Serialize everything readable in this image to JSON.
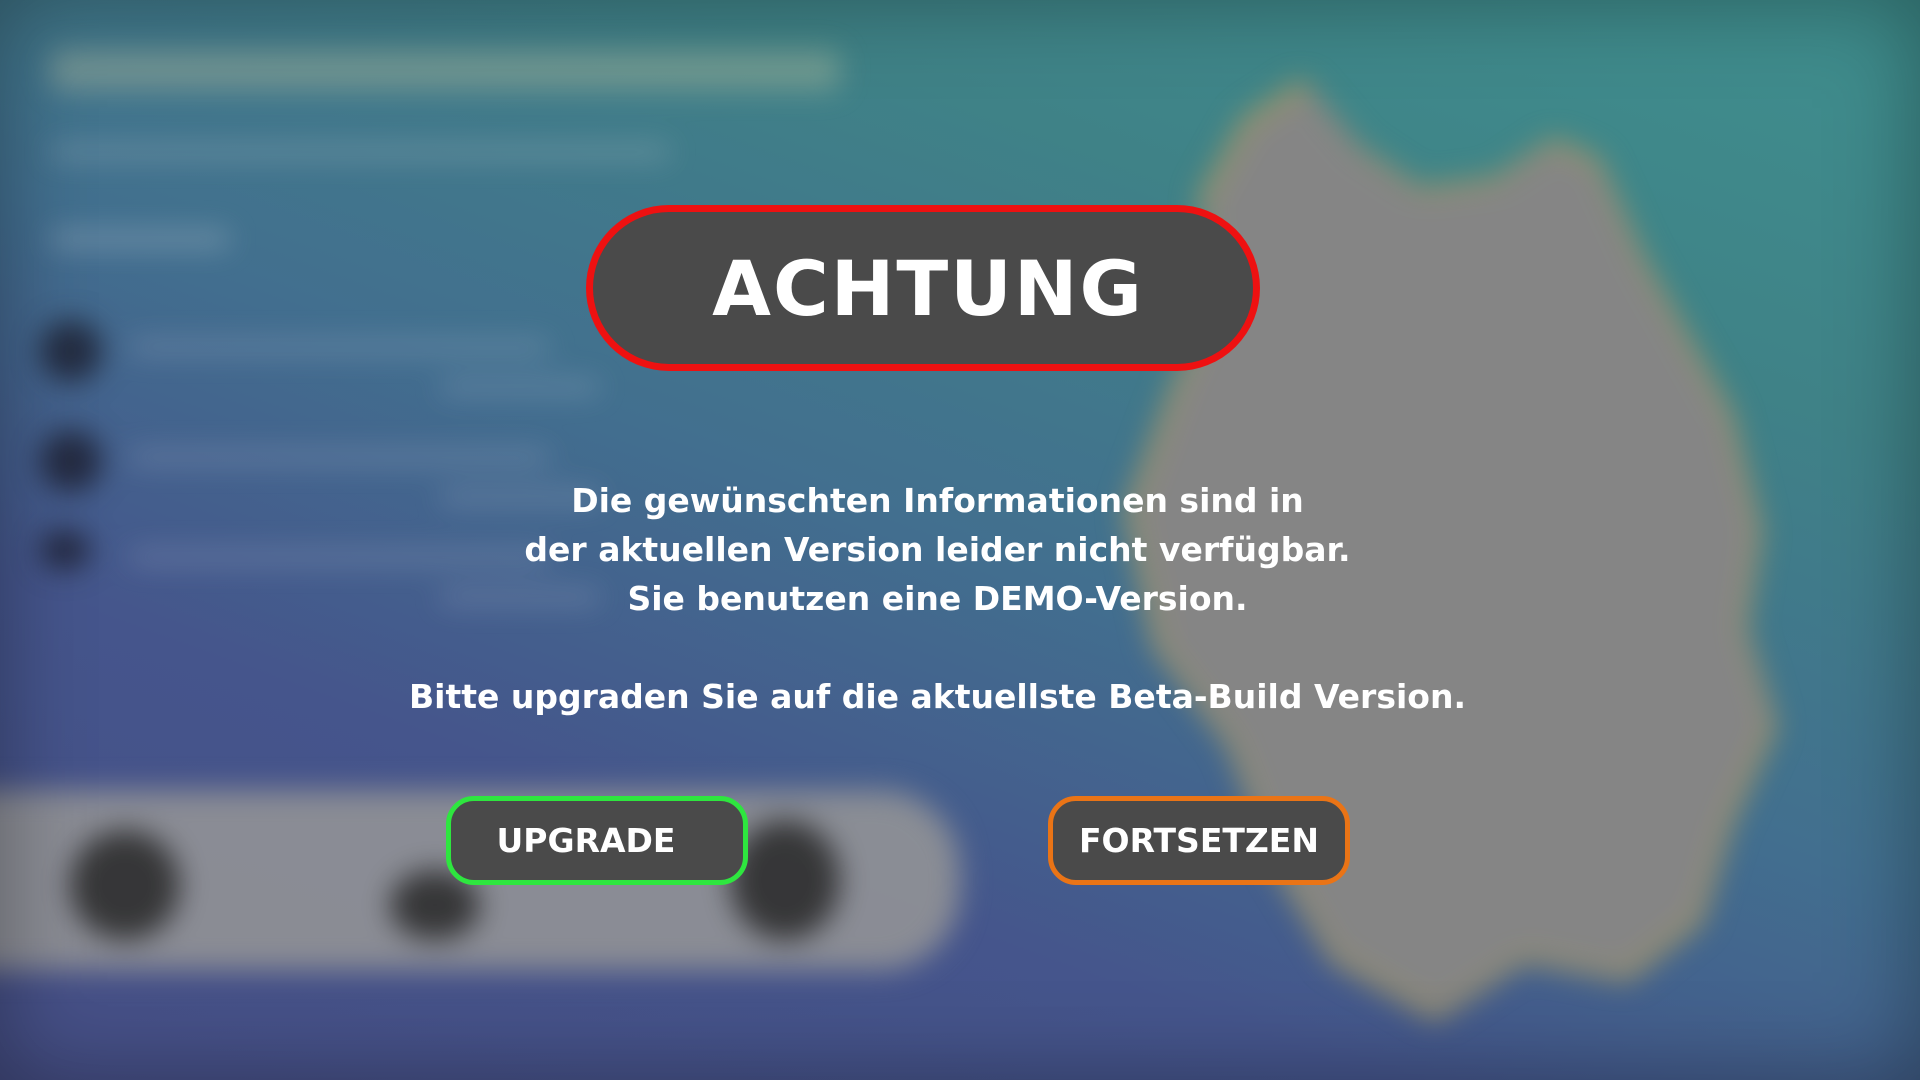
{
  "dialog": {
    "title": "ACHTUNG",
    "message_lines": [
      "Die gewünschten Informationen sind in",
      "der aktuellen Version leider nicht verfügbar.",
      "Sie benutzen eine DEMO-Version."
    ],
    "upgrade_note": "Bitte upgraden Sie auf die aktuellste Beta-Build Version.",
    "buttons": {
      "upgrade_label": "UPGRADE",
      "continue_label": "FORTSETZEN"
    },
    "colors": {
      "title_border": "#ee1111",
      "upgrade_border": "#2ee63f",
      "continue_border": "#ea7416",
      "pill_fill": "#4a4a4a"
    }
  },
  "background": {
    "description_visible": false,
    "map_icon": "germany-map-icon"
  }
}
